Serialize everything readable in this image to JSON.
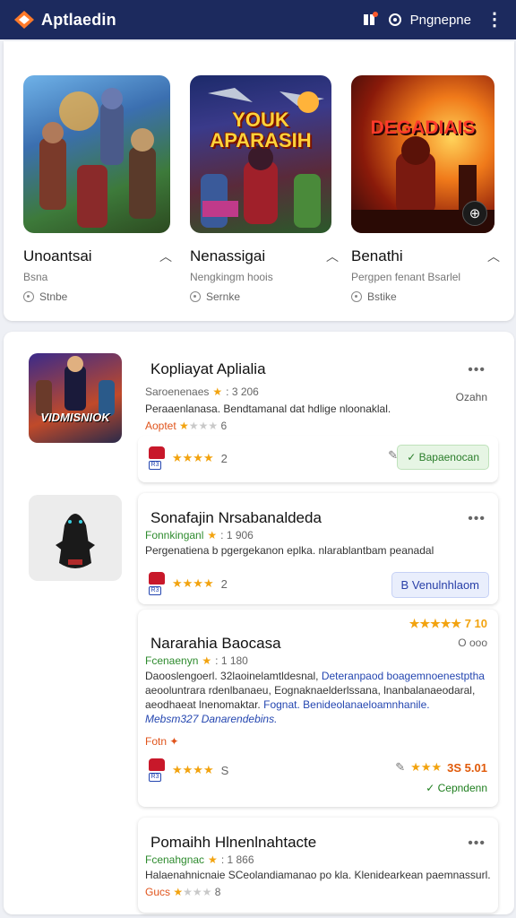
{
  "header": {
    "app_title": "Aptlaedin",
    "profile_label": "Pngnepne",
    "logo_icon": "app-logo-icon",
    "brand_color": "#1c2a5e"
  },
  "featured": [
    {
      "title": "Unoantsai",
      "subtitle": "Bsna",
      "meta": "Stnbe",
      "art_text": ""
    },
    {
      "title": "Nenassigai",
      "subtitle": "Nengkingm hoois",
      "meta": "Sernke",
      "art_text": "YOUK APARASIH"
    },
    {
      "title": "Benathi",
      "subtitle": "Pergpen fenant Bsarlel",
      "meta": "Bstike",
      "art_text": "DEGADIAIS"
    }
  ],
  "list": [
    {
      "title": "Kopliayat Aplialia",
      "meta": "Saroenenaes",
      "meta_rating": "3 206",
      "desc": "Peraaenlanasa. Bendtamanal dat hdlige nloonaklal.",
      "tag": "Aoptet",
      "tag_count": "6",
      "rating_count": "2",
      "side_label": "Ozahn",
      "action": "Bapaenocan",
      "thumb_text": "VIDMISNIOK"
    },
    {
      "title": "Sonafajin Nrsabanaldeda",
      "meta": "Fonnkinganl",
      "meta_rating": "1 906",
      "desc": "Pergenatiena b pgergekanon eplka. nlarablantbam peanadal",
      "rating_count": "2",
      "action": "Venulnhlaom"
    },
    {
      "title": "Nararahia Baocasa",
      "meta": "Fcenaenyn",
      "meta_rating": "1 180",
      "desc_1": "Daooslengoerl. 32laoinelamtldesnal,",
      "desc_1b": "Deteranpaod boagemnoenestptha",
      "desc_2": "aeooluntrara rdenlbanaeu, Eognaknaelderlssana, lnanbalanaeodaral,",
      "desc_3a": "aeodhaeat lnenomaktar.",
      "desc_3b": "Fognat. Benideolanaeloamnhanile.",
      "desc_4": "Mebsm327 Danarendebins.",
      "tag": "Fotn",
      "rating_count": "S",
      "top_rating": "7 10",
      "right_meta": "O ooo",
      "right_rating": "3S 5.01",
      "status": "Cepndenn"
    },
    {
      "title": "Pomaihh Hlnenlnahtacte",
      "meta": "Fcenahgnac",
      "meta_rating": "1 866",
      "desc": "Halaenahnicnaie SCeolandiamanao po kla. Klenidearkean paemnassurl.",
      "tag": "Gucs",
      "tag_count": "8"
    }
  ],
  "colors": {
    "accent_green": "#2a7d2a",
    "accent_blue": "#2940a8",
    "star": "#f2a30f",
    "tag_orange": "#e0541c"
  }
}
